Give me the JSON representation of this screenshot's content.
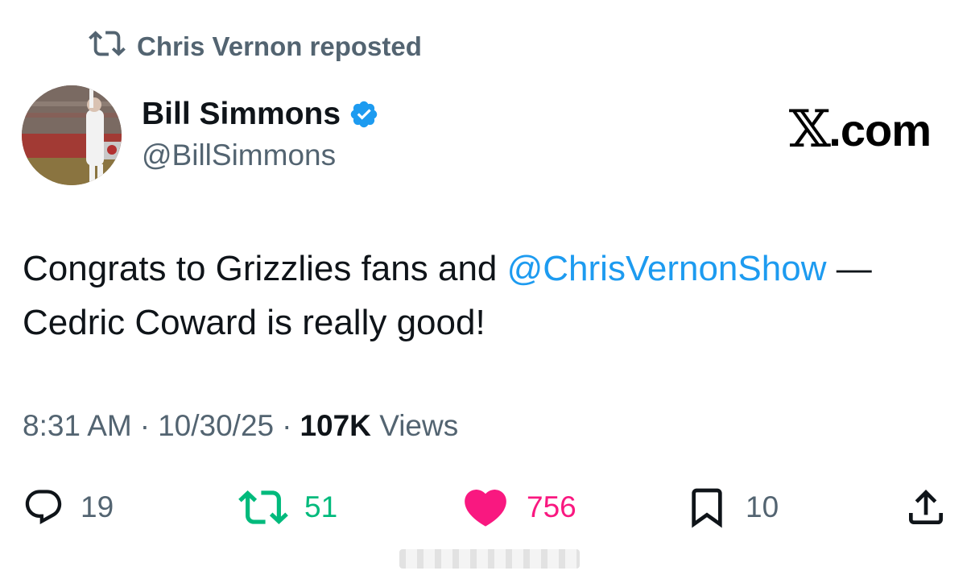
{
  "repost": {
    "icon": "repost-icon",
    "label": "Chris Vernon reposted"
  },
  "author": {
    "name": "Bill Simmons",
    "handle": "@BillSimmons",
    "verified_icon": "verified-badge-icon",
    "verified_color": "#1d9bf0"
  },
  "brand": {
    "x": "𝕏",
    "suffix": ".com"
  },
  "tweet": {
    "line1_before": "Congrats to Grizzlies fans and ",
    "mention": "@ChrisVernonShow",
    "line1_after": " —",
    "line2": "Cedric Coward is really good!"
  },
  "meta": {
    "time": "8:31 AM",
    "sep1": "·",
    "date": "10/30/25",
    "sep2": "·",
    "views_count": "107K",
    "views_label": "Views"
  },
  "actions": {
    "reply": {
      "icon": "reply-icon",
      "count": "19"
    },
    "repost": {
      "icon": "repost-icon",
      "count": "51",
      "color": "#00ba7c"
    },
    "like": {
      "icon": "heart-icon",
      "count": "756",
      "color": "#f91880"
    },
    "bookmark": {
      "icon": "bookmark-icon",
      "count": "10"
    },
    "share": {
      "icon": "share-icon"
    }
  },
  "colors": {
    "text": "#0f1419",
    "secondary": "#536471",
    "link": "#1d9bf0"
  }
}
